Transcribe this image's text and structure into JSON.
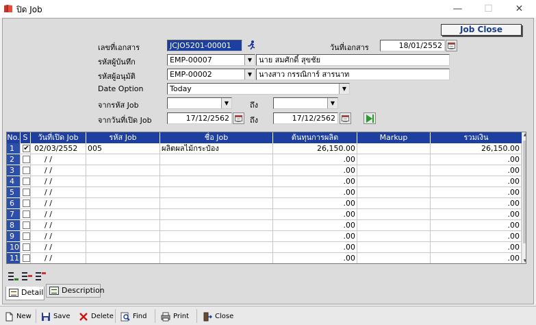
{
  "window": {
    "title": "ปิด Job",
    "min_glyph": "—",
    "max_glyph": "☐",
    "close_glyph": "✕",
    "icon": "book-icon"
  },
  "job_close_button": "Job Close",
  "form": {
    "doc_no_label": "เลขที่เอกสาร",
    "doc_no": "JCJO5201-00001",
    "doc_date_label": "วันที่เอกสาร",
    "doc_date": "18/01/2552",
    "recorder_label": "รหัสผู้บันทึก",
    "recorder_code": "EMP-00007",
    "recorder_name": "นาย สมศักดิ์  สุขชัย",
    "approver_label": "รหัสผู้อนุมัติ",
    "approver_code": "EMP-00002",
    "approver_name": "นางสาว กรรณิการ์ สารนาท",
    "date_option_label": "Date Option",
    "date_option": "Today",
    "from_job_label": "จากรหัส Job",
    "from_job": "",
    "to_label": "ถึง",
    "to_job": "",
    "from_open_date_label": "จากวันที่เปิด Job",
    "from_open_date": "17/12/2562",
    "to_label2": "ถึง",
    "to_open_date": "17/12/2562"
  },
  "grid": {
    "columns": [
      "No.",
      "S",
      "วันที่เปิด Job",
      "รหัส Job",
      "ชื่อ Job",
      "ต้นทุนการผลิต",
      "Markup",
      "รวมเงิน"
    ],
    "rows": [
      {
        "no": "1",
        "checked": true,
        "date": "02/03/2552",
        "code": "005",
        "name": "ผลิตผลไม้กระป๋อง",
        "cost": "26,150.00",
        "markup": "",
        "total": "26,150.00"
      },
      {
        "no": "2",
        "checked": false,
        "date": "/ /",
        "code": "",
        "name": "",
        "cost": ".00",
        "markup": "",
        "total": ".00"
      },
      {
        "no": "3",
        "checked": false,
        "date": "/ /",
        "code": "",
        "name": "",
        "cost": ".00",
        "markup": "",
        "total": ".00"
      },
      {
        "no": "4",
        "checked": false,
        "date": "/ /",
        "code": "",
        "name": "",
        "cost": ".00",
        "markup": "",
        "total": ".00"
      },
      {
        "no": "5",
        "checked": false,
        "date": "/ /",
        "code": "",
        "name": "",
        "cost": ".00",
        "markup": "",
        "total": ".00"
      },
      {
        "no": "6",
        "checked": false,
        "date": "/ /",
        "code": "",
        "name": "",
        "cost": ".00",
        "markup": "",
        "total": ".00"
      },
      {
        "no": "7",
        "checked": false,
        "date": "/ /",
        "code": "",
        "name": "",
        "cost": ".00",
        "markup": "",
        "total": ".00"
      },
      {
        "no": "8",
        "checked": false,
        "date": "/ /",
        "code": "",
        "name": "",
        "cost": ".00",
        "markup": "",
        "total": ".00"
      },
      {
        "no": "9",
        "checked": false,
        "date": "/ /",
        "code": "",
        "name": "",
        "cost": ".00",
        "markup": "",
        "total": ".00"
      },
      {
        "no": "10",
        "checked": false,
        "date": "/ /",
        "code": "",
        "name": "",
        "cost": ".00",
        "markup": "",
        "total": ".00"
      },
      {
        "no": "11",
        "checked": false,
        "date": "/ /",
        "code": "",
        "name": "",
        "cost": ".00",
        "markup": "",
        "total": ".00"
      }
    ]
  },
  "tabs": {
    "detail": "Detail",
    "description": "Description"
  },
  "toolbar": {
    "new": "New",
    "save": "Save",
    "delete": "Delete",
    "find": "Find",
    "print": "Print",
    "close": "Close"
  },
  "colors": {
    "selection": "#1c3fa0",
    "job_close_text": "#1a3f8f"
  }
}
